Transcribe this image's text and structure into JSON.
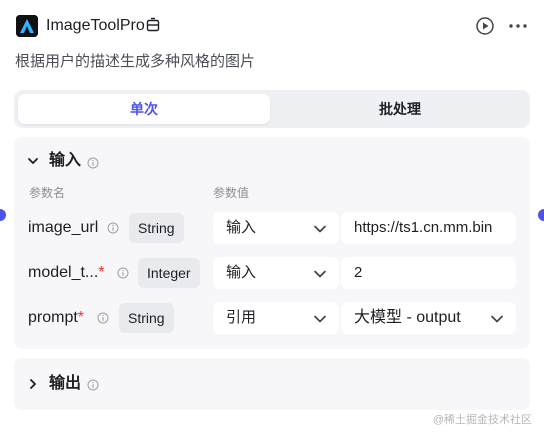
{
  "header": {
    "title": "ImageToolPro",
    "description": "根据用户的描述生成多种风格的图片",
    "icons": [
      "app-logo",
      "box-icon",
      "run-icon",
      "more-icon"
    ]
  },
  "tabs": [
    {
      "label": "单次",
      "active": true
    },
    {
      "label": "批处理",
      "active": false
    }
  ],
  "input_section": {
    "title": "输入",
    "col_name": "参数名",
    "col_value": "参数值",
    "params": [
      {
        "name": "image_url",
        "required": false,
        "type": "String",
        "mode": "输入",
        "value": "https://ts1.cn.mm.bin"
      },
      {
        "name": "model_t...",
        "required": true,
        "type": "Integer",
        "mode": "输入",
        "value": "2"
      },
      {
        "name": "prompt",
        "required": true,
        "type": "String",
        "mode": "引用",
        "value": "大模型 - output"
      }
    ]
  },
  "output_section": {
    "title": "输出"
  },
  "required_mark": "*",
  "watermark": "@稀土掘金技术社区",
  "colors": {
    "accent": "#4d53e8",
    "required": "#f23030",
    "panel": "#f7f7f9",
    "tag": "#e9eaee"
  }
}
